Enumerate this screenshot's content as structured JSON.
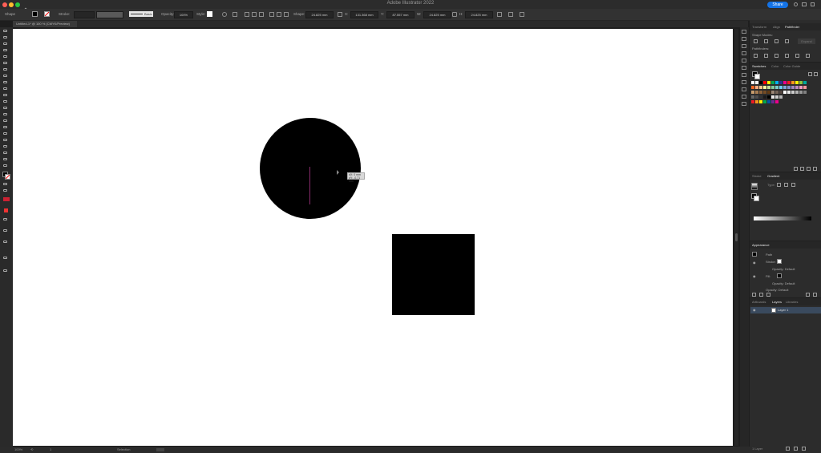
{
  "window": {
    "title": "Adobe Illustrator 2022"
  },
  "header": {
    "share_label": "Share"
  },
  "controlbar": {
    "object_type": "Shape",
    "stroke_label": "Stroke:",
    "brush_label": "Basic",
    "opacity_label": "Opacity:",
    "opacity_value": "100%",
    "style_label": "Style:",
    "shape_label": "Shape:",
    "corner_value": "24.825 mm",
    "x_label": "X:",
    "x_value": "131.368 mm",
    "y_label": "Y:",
    "y_value": "87.557 mm",
    "w_label": "W:",
    "w_value": "24.825 mm",
    "h_label": "H:",
    "h_value": "24.825 mm"
  },
  "document": {
    "tab_label": "Untitled-1* @ 100 % (CMYK/Preview)"
  },
  "canvas": {
    "tooltip_line1": "dX: 0 mm",
    "tooltip_line2": "dY: -0.71 mm"
  },
  "statusbar": {
    "zoom": "100%",
    "artboard_number": "1",
    "tool_name": "Selection"
  },
  "panels": {
    "top_tabs": [
      "Transform",
      "Align",
      "Pathfinder"
    ],
    "shape_modes_label": "Shape Modes:",
    "expand_label": "Expand",
    "pathfinders_label": "Pathfinders:",
    "swatch_tabs": [
      "Swatches",
      "Color",
      "Color Guide"
    ],
    "gradient_tabs": [
      "Stroke",
      "Gradient"
    ],
    "gradient_type_label": "Type:",
    "appearance_title": "Appearance",
    "appearance_path_label": "Path",
    "appearance_stroke_label": "Stroke:",
    "appearance_opacity1": "Opacity: Default",
    "appearance_fill_label": "Fill:",
    "appearance_opacity2": "Opacity: Default",
    "appearance_opacity3": "Opacity: Default",
    "layer_tabs": [
      "Artboards",
      "Layers",
      "Libraries"
    ],
    "layer_name": "Layer 1",
    "layers_count": "1 Layer"
  },
  "colors": {
    "canvas": "#ffffff",
    "shape_fill": "#000000",
    "accent": "#1473e6",
    "panel_bg": "#2c2c2c",
    "stroke_line": "#8a2b6e"
  },
  "swatches": [
    [
      "#ffffff",
      "#f2f2f2",
      "#000000",
      "#ff0000",
      "#ffff00",
      "#00a651",
      "#00aeef",
      "#2e3192",
      "#ec008c",
      "#ed1c24",
      "#f7941d",
      "#fff200",
      "#8dc63f",
      "#00a99d"
    ],
    [
      "#f26522",
      "#f9ad81",
      "#fdc689",
      "#fff79a",
      "#c4df9b",
      "#82ca9c",
      "#7accc8",
      "#6dcff6",
      "#7ea7d8",
      "#8493ca",
      "#a187be",
      "#bc8dbf",
      "#f49ac2",
      "#f6989d"
    ],
    [
      "#c69c6d",
      "#a67c52",
      "#8c6239",
      "#754c24",
      "#603913",
      "#998675",
      "#736357",
      "#534741",
      "#ffffff",
      "#e6e6e6",
      "#cccccc",
      "#b3b3b3",
      "#999999",
      "#808080"
    ],
    [
      "#666666",
      "#4d4d4d",
      "#333333",
      "#1a1a1a",
      "#000000",
      "#e6e6e6",
      "#cccccc",
      "#b3b3b3"
    ],
    [
      "#ed1c24",
      "#f7941d",
      "#fff200",
      "#00a651",
      "#0054a6",
      "#662d91",
      "#ec008c"
    ]
  ]
}
